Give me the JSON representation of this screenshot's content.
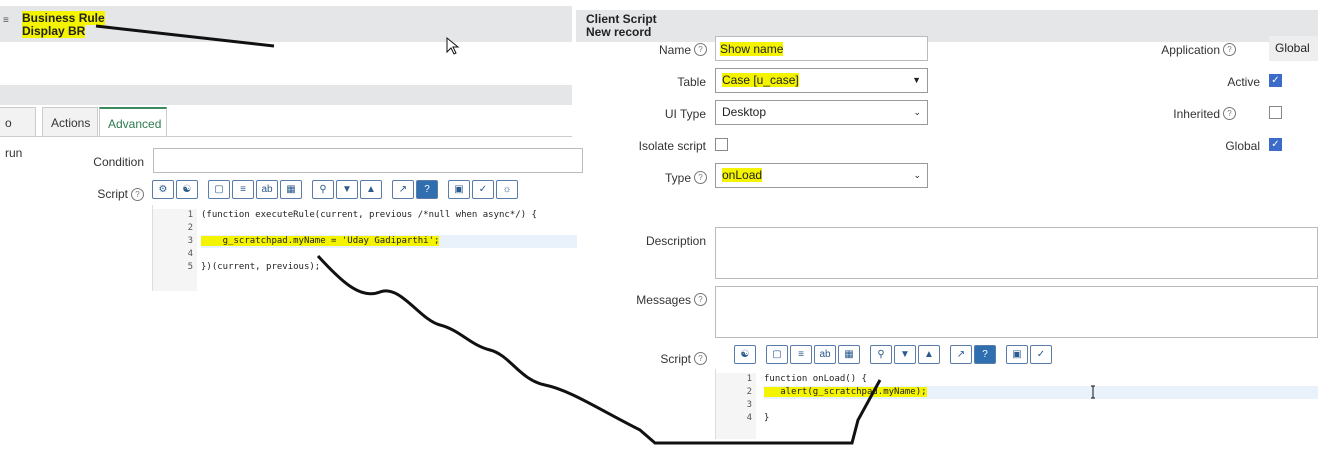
{
  "left": {
    "header": {
      "menu_icon": "menu-icon",
      "title": "Business Rule",
      "subtitle": "Display BR"
    },
    "tabs": [
      {
        "label": "o run",
        "active": false
      },
      {
        "label": "Actions",
        "active": false
      },
      {
        "label": "Advanced",
        "active": true
      }
    ],
    "fields": {
      "condition_label": "Condition",
      "script_label": "Script"
    },
    "code_lines": [
      {
        "n": "1",
        "text": "(function executeRule(current, previous /*null when async*/) {"
      },
      {
        "n": "2",
        "text": ""
      },
      {
        "n": "3",
        "text": "    g_scratchpad.myName = 'Uday Gadiparthi';"
      },
      {
        "n": "4",
        "text": ""
      },
      {
        "n": "5",
        "text": "})(current, previous);"
      }
    ]
  },
  "right": {
    "header": {
      "title": "Client Script",
      "subtitle": "New record"
    },
    "fields": {
      "name_label": "Name",
      "name_value": "Show name",
      "table_label": "Table",
      "table_value": "Case [u_case]",
      "ui_type_label": "UI Type",
      "ui_type_value": "Desktop",
      "isolate_label": "Isolate script",
      "type_label": "Type",
      "type_value": "onLoad",
      "description_label": "Description",
      "messages_label": "Messages",
      "script_label": "Script",
      "application_label": "Application",
      "application_value": "Global",
      "active_label": "Active",
      "inherited_label": "Inherited",
      "global_label": "Global"
    },
    "checks": {
      "isolate": false,
      "active": true,
      "inherited": false,
      "global": true
    },
    "code_lines": [
      {
        "n": "1",
        "text": "function onLoad() {"
      },
      {
        "n": "2",
        "text": "   alert(g_scratchpad.myName);"
      },
      {
        "n": "3",
        "text": ""
      },
      {
        "n": "4",
        "text": "}"
      }
    ]
  },
  "colors": {
    "highlight": "#f4f300",
    "accent_green": "#2e7a4f",
    "checkbox_blue": "#3d6bc9"
  }
}
